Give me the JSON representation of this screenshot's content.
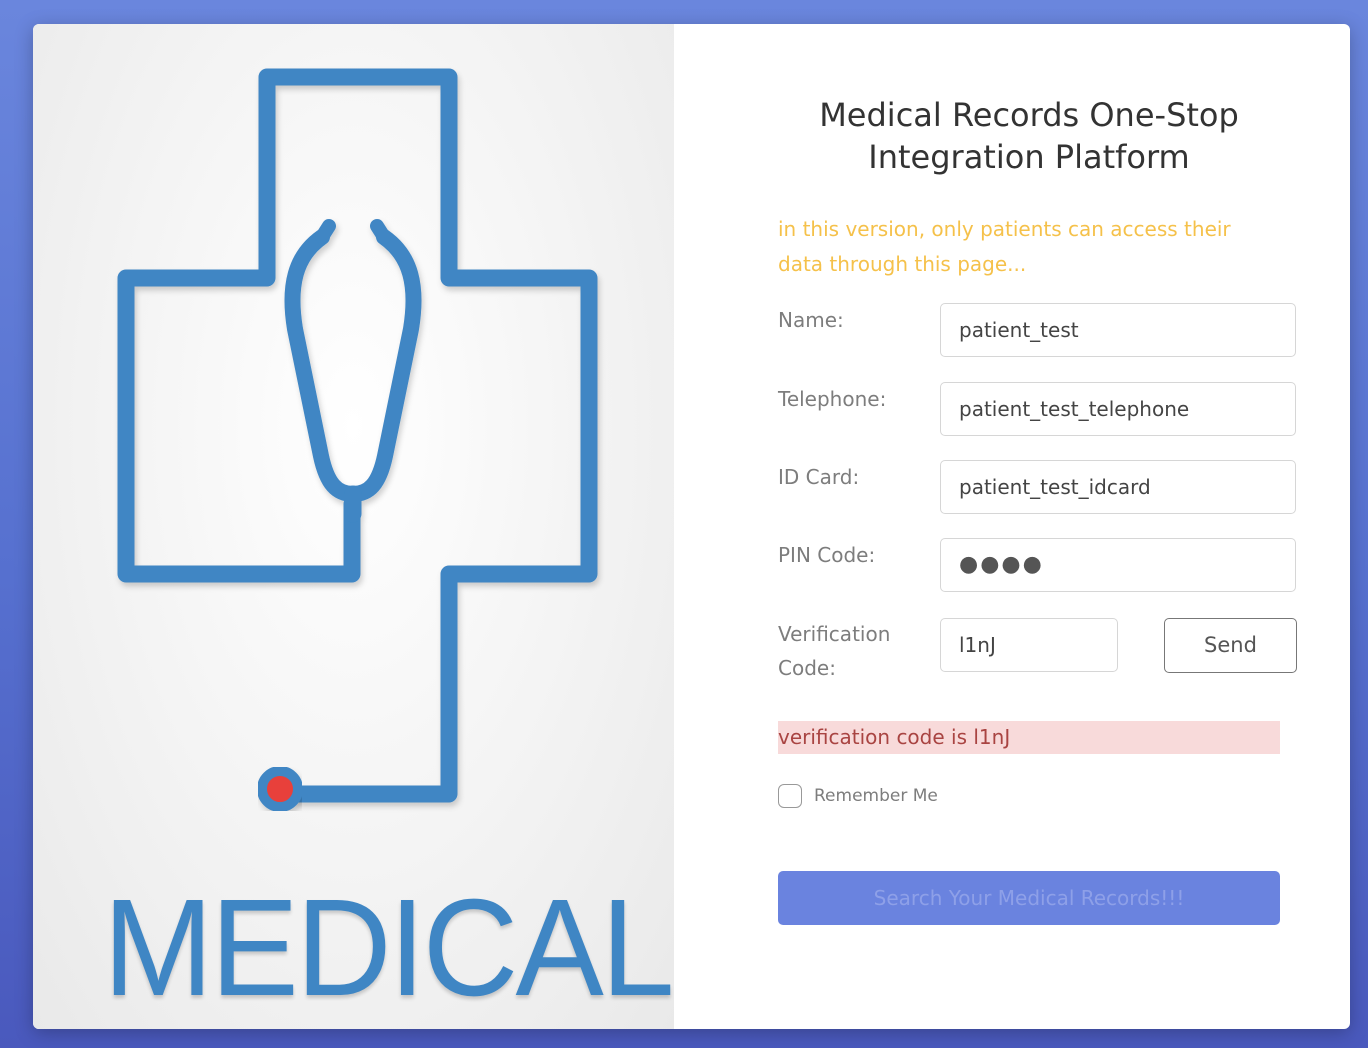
{
  "brand": {
    "logo_text": "MEDICAL"
  },
  "title": "Medical Records One-Stop Integration Platform",
  "notice": "in this version, only patients can access their data through this page...",
  "form": {
    "name": {
      "label": "Name:",
      "value": "patient_test"
    },
    "telephone": {
      "label": "Telephone:",
      "value": "patient_test_telephone"
    },
    "id_card": {
      "label": "ID Card:",
      "value": "patient_test_idcard"
    },
    "pin": {
      "label": "PIN Code:",
      "value": "●●●●"
    },
    "verification": {
      "label_line1": "Verification",
      "label_line2": "Code:",
      "value": "l1nJ"
    },
    "send_label": "Send",
    "alert": "verification code is l1nJ",
    "remember_label": "Remember Me",
    "submit_label": "Search Your Medical Records!!!"
  },
  "colors": {
    "background": "#5670cf",
    "accent": "#6a83df",
    "notice": "#f5c14a",
    "alert_bg": "#f8dada",
    "alert_text": "#a94442",
    "logo_blue": "#3f86c4",
    "logo_dot": "#e8413b"
  }
}
